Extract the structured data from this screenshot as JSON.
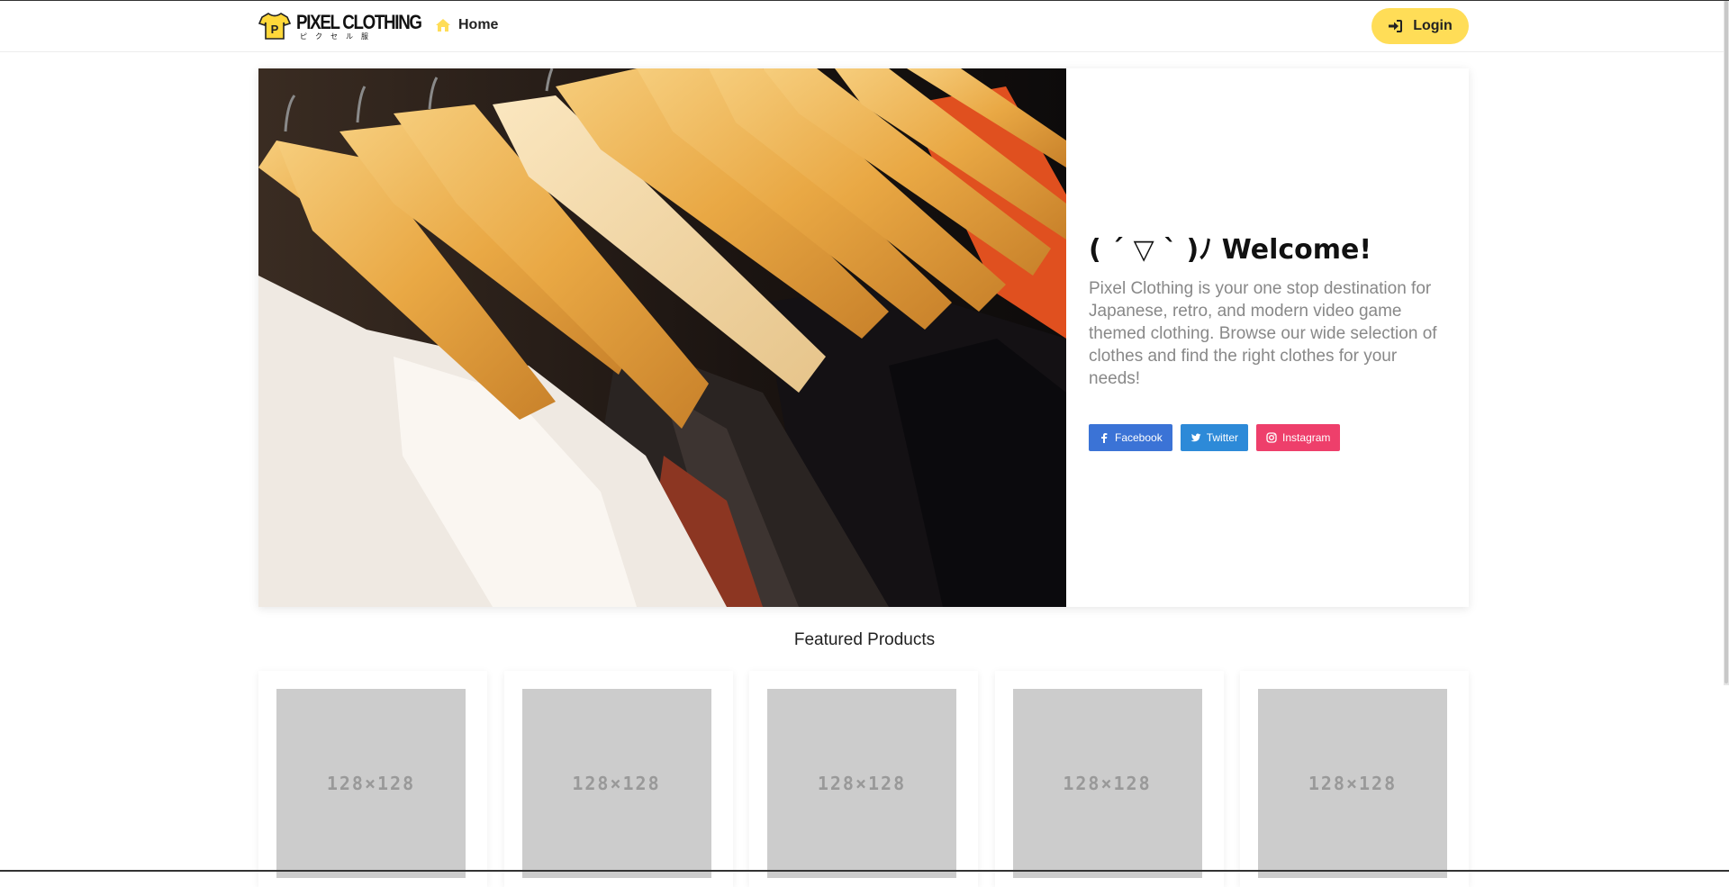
{
  "navbar": {
    "brand_title": "PIXEL CLOTHING",
    "brand_subtitle": "ピクセル服",
    "brand_logo_letter": "P",
    "home_label": "Home",
    "login_label": "Login",
    "icons": {
      "home": "home-icon",
      "login": "sign-in-icon",
      "logo": "shirt-logo-icon"
    }
  },
  "hero": {
    "title": "( ´ ▽ ` )ﾉ Welcome!",
    "description": "Pixel Clothing is your one stop destination for Japanese, retro, and modern video game themed clothing. Browse our wide selection of clothes and find the right clothes for your needs!",
    "social": [
      {
        "label": "Facebook",
        "icon": "facebook-icon",
        "color": "#3b73d6"
      },
      {
        "label": "Twitter",
        "icon": "twitter-icon",
        "color": "#2d8ad8"
      },
      {
        "label": "Instagram",
        "icon": "instagram-icon",
        "color": "#ee3f6b"
      }
    ]
  },
  "featured": {
    "heading": "Featured Products",
    "products": [
      {
        "placeholder": "128×128"
      },
      {
        "placeholder": "128×128"
      },
      {
        "placeholder": "128×128"
      },
      {
        "placeholder": "128×128"
      },
      {
        "placeholder": "128×128"
      }
    ]
  },
  "colors": {
    "accent": "#ffdd57",
    "placeholder_gray": "#cccccc"
  }
}
